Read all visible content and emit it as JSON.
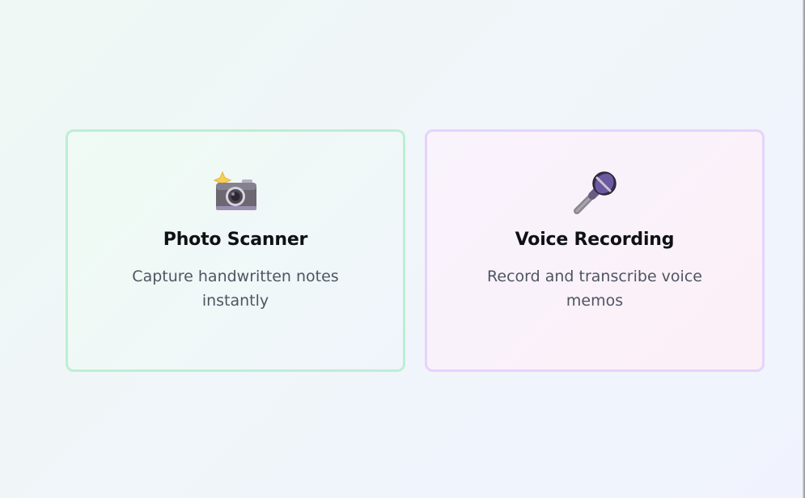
{
  "cards": [
    {
      "icon": "camera-with-flash-icon",
      "title": "Photo Scanner",
      "description": "Capture handwritten notes instantly",
      "accent": "#bcefd3"
    },
    {
      "icon": "microphone-icon",
      "title": "Voice Recording",
      "description": "Record and transcribe voice memos",
      "accent": "#e6d3fb"
    }
  ]
}
